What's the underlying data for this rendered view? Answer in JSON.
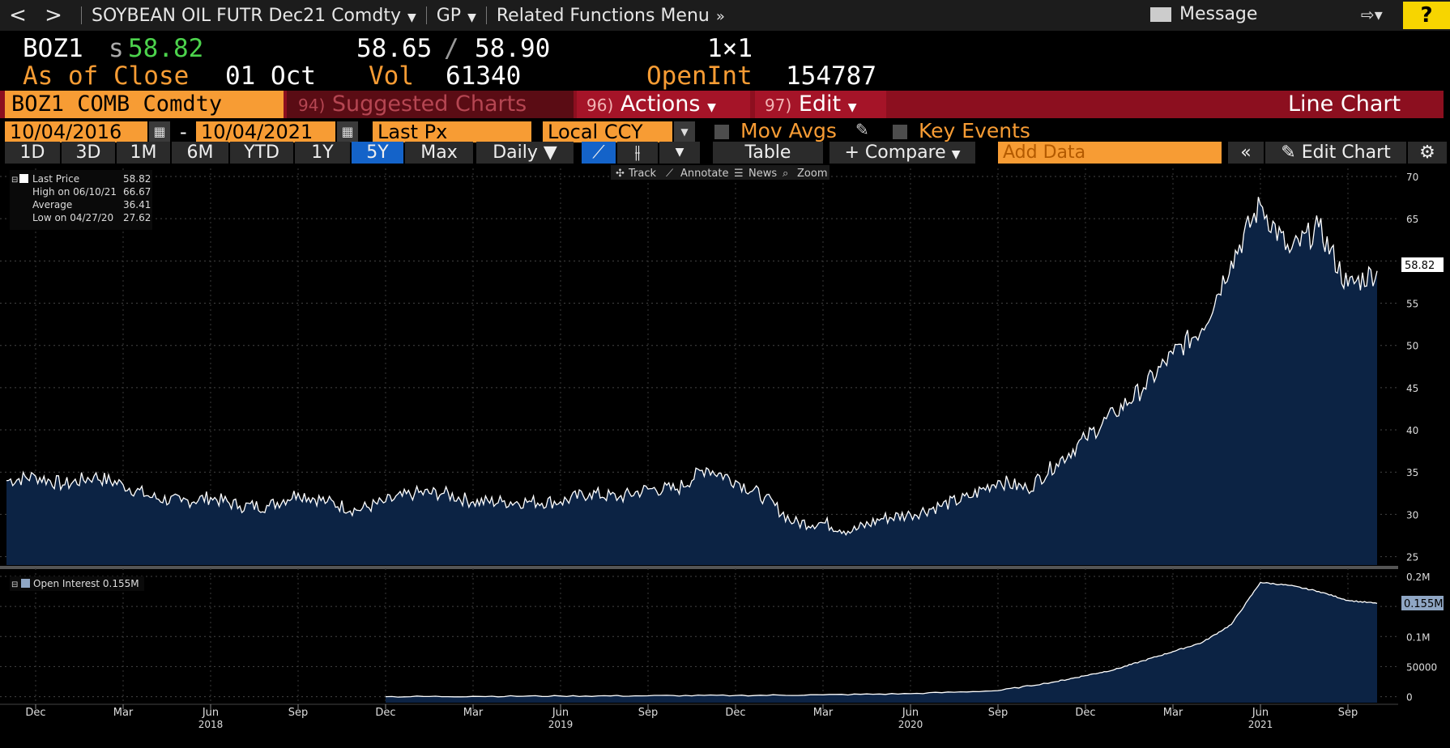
{
  "topbar": {
    "back": "<",
    "forward": ">",
    "security": "SOYBEAN OIL FUTR Dec21 Comdty",
    "func": "GP",
    "related": "Related Functions Menu",
    "message": "Message",
    "help": "?"
  },
  "quote": {
    "ticker": "BOZ1",
    "price_prefix": "s",
    "price": "58.82",
    "bid": "58.65",
    "slash": "/",
    "ask": "58.90",
    "size": "1×1",
    "as_of_label": "As of Close",
    "as_of_date": "01 Oct",
    "vol_label": "Vol",
    "vol": "61340",
    "openint_label": "OpenInt",
    "openint": "154787"
  },
  "ribbon": {
    "security_box": "BOZ1 COMB Comdty",
    "suggested_num": "94)",
    "suggested": "Suggested Charts",
    "actions_num": "96)",
    "actions": "Actions",
    "edit_num": "97)",
    "edit": "Edit",
    "chart_type": "Line Chart"
  },
  "controls": {
    "start_date": "10/04/2016",
    "dash": "-",
    "end_date": "10/04/2021",
    "field": "Last Px",
    "currency": "Local CCY",
    "mov_avgs": "Mov Avgs",
    "key_events": "Key Events"
  },
  "range_buttons": [
    "1D",
    "3D",
    "1M",
    "6M",
    "YTD",
    "1Y",
    "5Y",
    "Max"
  ],
  "active_range": "5Y",
  "toolbar": {
    "period": "Daily",
    "table": "Table",
    "compare": "+ Compare",
    "add_data_placeholder": "Add Data",
    "edit_chart": "Edit Chart"
  },
  "chart_tools": [
    "Track",
    "Annotate",
    "News",
    "Zoom"
  ],
  "legend": {
    "last_price_label": "Last Price",
    "last_price": "58.82",
    "high_label": "High on 06/10/21",
    "high": "66.67",
    "avg_label": "Average",
    "avg": "36.41",
    "low_label": "Low on 04/27/20",
    "low": "27.62",
    "oi_label": "Open Interest 0.155M"
  },
  "colors": {
    "accent_orange": "#f79c34",
    "ribbon_red": "#8c0f1f",
    "area_fill": "#0c2344",
    "help_yellow": "#f7d500",
    "active_blue": "#1463c9"
  },
  "chart_data": [
    {
      "type": "area",
      "series": [
        {
          "name": "Last Price",
          "x": [
            "2017-11",
            "2017-12",
            "2018-01",
            "2018-02",
            "2018-03",
            "2018-04",
            "2018-05",
            "2018-06",
            "2018-07",
            "2018-08",
            "2018-09",
            "2018-10",
            "2018-11",
            "2018-12",
            "2019-01",
            "2019-02",
            "2019-03",
            "2019-04",
            "2019-05",
            "2019-06",
            "2019-07",
            "2019-08",
            "2019-09",
            "2019-10",
            "2019-11",
            "2019-12",
            "2020-01",
            "2020-02",
            "2020-03",
            "2020-04",
            "2020-05",
            "2020-06",
            "2020-07",
            "2020-08",
            "2020-09",
            "2020-10",
            "2020-11",
            "2020-12",
            "2021-01",
            "2021-02",
            "2021-03",
            "2021-04",
            "2021-05",
            "2021-06",
            "2021-07",
            "2021-08",
            "2021-09",
            "2021-10"
          ],
          "values": [
            34,
            34.5,
            33.5,
            34.5,
            33.5,
            32,
            31.5,
            32,
            31,
            31,
            32.5,
            31.5,
            30.5,
            31.5,
            32.5,
            32.5,
            31.5,
            31.5,
            31.5,
            31.5,
            32.5,
            32,
            33,
            33,
            35.5,
            34,
            32,
            29,
            29,
            28,
            29.5,
            30,
            31,
            32,
            34,
            33,
            36,
            39,
            42,
            45,
            49,
            52,
            60,
            66.67,
            61,
            64,
            57,
            58.82
          ]
        }
      ],
      "yticks": [
        25,
        30,
        35,
        40,
        45,
        50,
        55,
        60,
        65,
        70
      ],
      "ylim": [
        24,
        70
      ],
      "last_value_label": "58.82",
      "grid": true
    },
    {
      "type": "area",
      "series": [
        {
          "name": "Open Interest",
          "x": [
            "2018-12",
            "2019-03",
            "2019-06",
            "2019-09",
            "2019-12",
            "2020-03",
            "2020-06",
            "2020-09",
            "2020-11",
            "2020-12",
            "2021-01",
            "2021-02",
            "2021-03",
            "2021-04",
            "2021-05",
            "2021-06",
            "2021-07",
            "2021-08",
            "2021-09",
            "2021-10"
          ],
          "values": [
            0.0,
            0.0005,
            0.001,
            0.0015,
            0.002,
            0.003,
            0.005,
            0.01,
            0.025,
            0.035,
            0.045,
            0.06,
            0.075,
            0.09,
            0.12,
            0.19,
            0.185,
            0.175,
            0.16,
            0.155
          ]
        }
      ],
      "ytick_labels": [
        "0",
        "50000",
        "0.1M",
        "0.15M",
        "0.2M"
      ],
      "ytick_values": [
        0,
        0.05,
        0.1,
        0.15,
        0.2
      ],
      "ylim": [
        -0.01,
        0.2
      ],
      "last_value_label": "0.155M"
    }
  ],
  "xaxis": {
    "month_labels": [
      "Dec",
      "Mar",
      "Jun",
      "Sep",
      "Dec",
      "Mar",
      "Jun",
      "Sep",
      "Dec",
      "Mar",
      "Jun",
      "Sep",
      "Dec",
      "Mar",
      "Jun",
      "Sep"
    ],
    "month_dates": [
      "2017-12",
      "2018-03",
      "2018-06",
      "2018-09",
      "2018-12",
      "2019-03",
      "2019-06",
      "2019-09",
      "2019-12",
      "2020-03",
      "2020-06",
      "2020-09",
      "2020-12",
      "2021-03",
      "2021-06",
      "2021-09"
    ],
    "year_labels": [
      "2018",
      "2019",
      "2020",
      "2021"
    ],
    "year_dates": [
      "2018-06",
      "2019-06",
      "2020-06",
      "2021-06"
    ]
  }
}
